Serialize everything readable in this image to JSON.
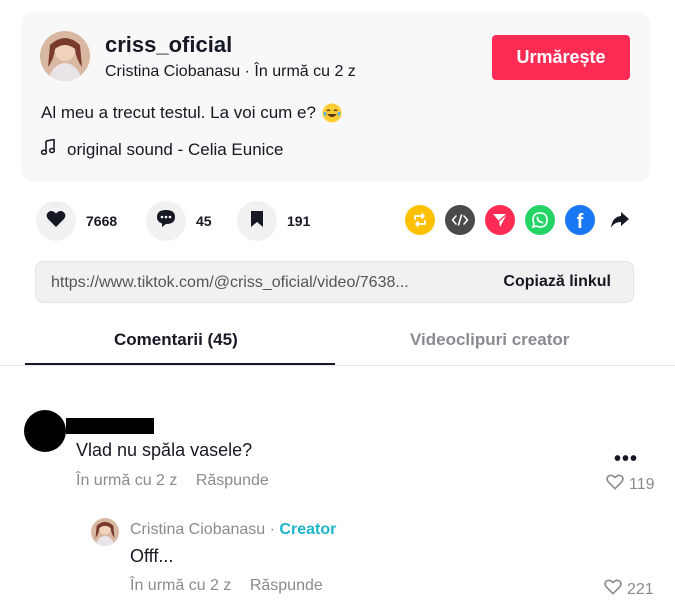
{
  "author": {
    "username": "criss_oficial",
    "display_name": "Cristina Ciobanasu",
    "separator": "·",
    "posted": "În urmă cu 2 z",
    "follow_label": "Urmărește"
  },
  "post": {
    "caption": "Al meu a trecut testul. La voi cum e?",
    "caption_emoji": "laughing-tears-emoji",
    "music_icon": "music-note-icon",
    "sound": "original sound - Celia Eunice"
  },
  "actions": {
    "likes": "7668",
    "comments": "45",
    "saves": "191"
  },
  "share": {
    "icons": [
      "repost-icon",
      "embed-icon",
      "send-icon",
      "whatsapp-icon",
      "facebook-icon",
      "share-arrow-icon"
    ],
    "colors": {
      "repost": "#fec100",
      "embed": "#4a4a4a",
      "send": "#fe2c55",
      "whatsapp": "#25d366",
      "facebook": "#1877f2"
    }
  },
  "link": {
    "url": "https://www.tiktok.com/@criss_oficial/video/7638...",
    "copy_label": "Copiază linkul"
  },
  "tabs": {
    "comments": "Comentarii (45)",
    "creator_videos": "Videoclipuri creator"
  },
  "comments": [
    {
      "text": "Vlad nu spăla vasele?",
      "time": "În urmă cu 2 z",
      "reply_label": "Răspunde",
      "more": "•••",
      "likes": "119"
    }
  ],
  "reply": {
    "name": "Cristina Ciobanasu",
    "separator": "·",
    "badge": "Creator",
    "text": "Offf...",
    "time": "În urmă cu 2 z",
    "reply_label": "Răspunde",
    "likes": "221"
  },
  "colors": {
    "accent": "#fe2c55",
    "creator_badge": "#20b4c9",
    "muted_text": "#8a8b91"
  }
}
